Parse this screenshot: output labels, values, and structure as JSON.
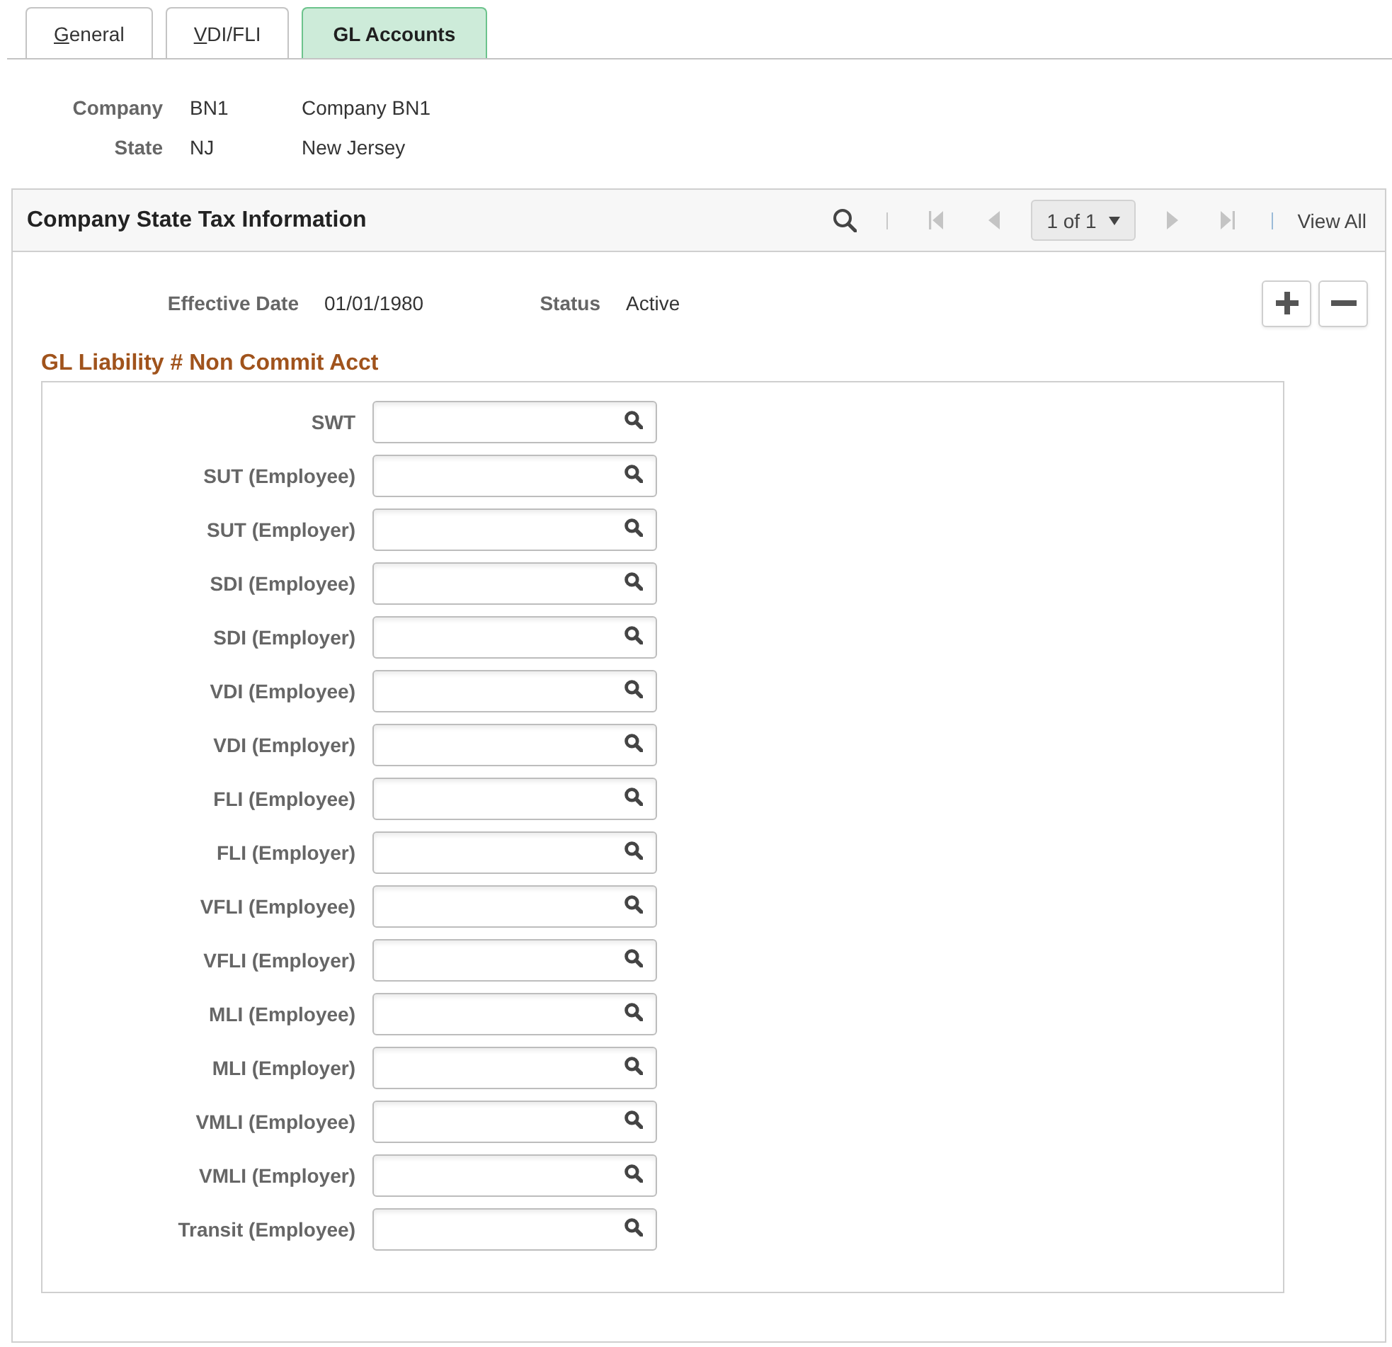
{
  "tabs": [
    {
      "label": "General",
      "selected": false,
      "underline_first": true
    },
    {
      "label": "VDI/FLI",
      "selected": false,
      "underline_first": true
    },
    {
      "label": "GL Accounts",
      "selected": true,
      "underline_first": false
    }
  ],
  "header_fields": [
    {
      "label": "Company",
      "code": "BN1",
      "description": "Company BN1"
    },
    {
      "label": "State",
      "code": "NJ",
      "description": "New Jersey"
    }
  ],
  "panel": {
    "title": "Company State Tax Information",
    "toolbar": {
      "nav": [
        {
          "kind": "first",
          "disabled": true
        },
        {
          "kind": "prev",
          "disabled": true
        },
        {
          "kind": "pager",
          "label": "1 of 1"
        },
        {
          "kind": "next",
          "disabled": true
        },
        {
          "kind": "last",
          "disabled": true
        }
      ],
      "view_all": "View All"
    },
    "fields": [
      {
        "label": "Effective Date",
        "value": "01/01/1980"
      },
      {
        "label": "Status",
        "value": "Active"
      }
    ],
    "section_title": "GL Liability # Non Commit Acct",
    "accounts": [
      {
        "label": "SWT"
      },
      {
        "label": "SUT (Employee)"
      },
      {
        "label": "SUT (Employer)"
      },
      {
        "label": "SDI (Employee)"
      },
      {
        "label": "SDI (Employer)"
      },
      {
        "label": "VDI (Employee)"
      },
      {
        "label": "VDI (Employer)"
      },
      {
        "label": "FLI (Employee)"
      },
      {
        "label": "FLI (Employer)"
      },
      {
        "label": "VFLI (Employee)"
      },
      {
        "label": "VFLI (Employer)"
      },
      {
        "label": "MLI (Employee)"
      },
      {
        "label": "MLI (Employer)"
      },
      {
        "label": "VMLI (Employee)"
      },
      {
        "label": "VMLI (Employer)"
      },
      {
        "label": "Transit (Employee)"
      }
    ]
  }
}
